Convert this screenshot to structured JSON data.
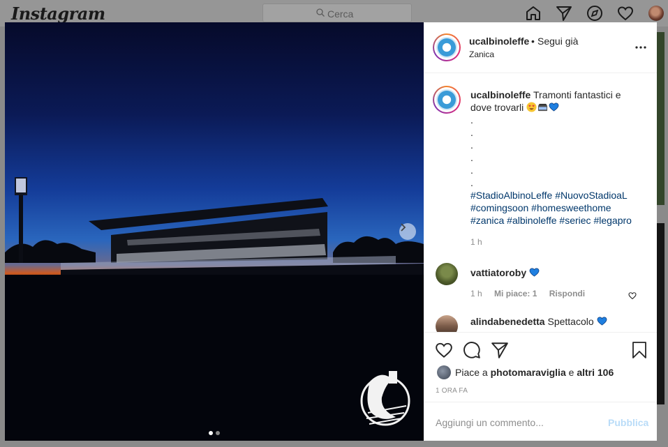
{
  "app": {
    "name": "Instagram"
  },
  "search": {
    "placeholder": "Cerca"
  },
  "nav": {
    "icons": [
      "home-icon",
      "direct-icon",
      "explore-icon",
      "activity-icon",
      "profile-avatar"
    ]
  },
  "post": {
    "username": "ucalbinoleffe",
    "separator": "•",
    "follow_status": "Segui già",
    "location": "Zanica",
    "caption": {
      "username": "ucalbinoleffe",
      "text_line1": "Tramonti fantastici e",
      "text_line2": "dove trovarli",
      "emojis": [
        "heart-eyes-emoji",
        "stadium-emoji",
        "blue-heart-emoji"
      ],
      "dots": [
        ".",
        ".",
        ".",
        ".",
        ".",
        "."
      ],
      "hashtags": [
        "#StadioAlbinoLeffe",
        "#NuovoStadioaL",
        "#comingsoon",
        "#homesweethome",
        "#zanica",
        "#albinoleffe",
        "#seriec",
        "#legapro"
      ],
      "time": "1 h"
    },
    "comments": [
      {
        "username": "vattiatoroby",
        "text": "",
        "emoji": "blue-heart-emoji",
        "time": "1 h",
        "likes": "Mi piace: 1",
        "reply": "Rispondi"
      },
      {
        "username": "alindabenedetta",
        "text": "Spettacolo",
        "emoji": "blue-heart-emoji"
      }
    ],
    "likes": {
      "prefix": "Piace a",
      "user": "photomaraviglia",
      "joiner": "e",
      "others": "altri 106"
    },
    "posted_ago": "1 ORA FA",
    "add_comment": {
      "placeholder": "Aggiungi un commento...",
      "publish": "Pubblica"
    },
    "carousel": {
      "current": 1,
      "total": 2
    }
  },
  "colors": {
    "link": "#00376b",
    "publish_disabled": "#b9dcf8",
    "blue_heart": "#1f7fe0"
  }
}
